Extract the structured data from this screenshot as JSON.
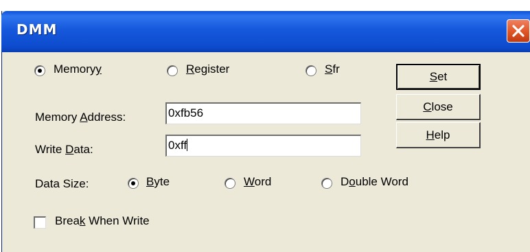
{
  "window": {
    "title": "DMM"
  },
  "target": {
    "options": [
      {
        "pre": "Memory",
        "acc": "y",
        "post": "",
        "selected": true
      },
      {
        "pre": "",
        "acc": "R",
        "post": "egister",
        "selected": false
      },
      {
        "pre": "",
        "acc": "S",
        "post": "fr",
        "selected": false
      }
    ]
  },
  "memory_address": {
    "label_pre": "Memory ",
    "label_acc": "A",
    "label_post": "ddress:",
    "value": "0xfb56"
  },
  "write_data": {
    "label_pre": "Write ",
    "label_acc": "D",
    "label_post": "ata:",
    "value": "0xff"
  },
  "data_size": {
    "label": "Data Size:",
    "options": [
      {
        "pre": "",
        "acc": "B",
        "post": "yte",
        "selected": true
      },
      {
        "pre": "",
        "acc": "W",
        "post": "ord",
        "selected": false
      },
      {
        "pre": "D",
        "acc": "o",
        "post": "uble Word",
        "selected": false
      }
    ]
  },
  "break_when_write": {
    "pre": "Brea",
    "acc": "k",
    "post": " When Write",
    "checked": false
  },
  "buttons": {
    "set": {
      "acc": "S",
      "post": "et"
    },
    "close": {
      "acc": "C",
      "post": "lose"
    },
    "help": {
      "acc": "H",
      "post": "elp"
    }
  }
}
